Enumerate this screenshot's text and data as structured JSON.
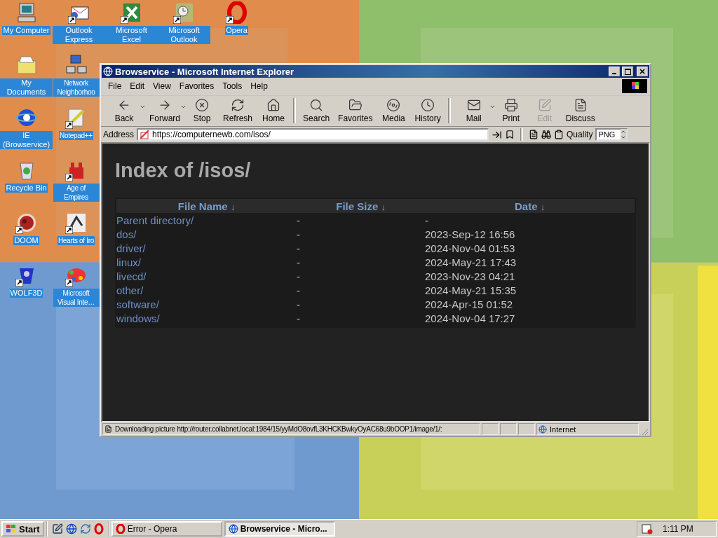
{
  "desktop_icons": [
    {
      "label": "My Computer",
      "shortcut": false
    },
    {
      "label": "Outlook Express",
      "shortcut": true
    },
    {
      "label": "Microsoft Excel",
      "shortcut": true
    },
    {
      "label": "Microsoft Outlook",
      "shortcut": true
    },
    {
      "label": "Opera",
      "shortcut": true
    },
    {
      "label": "My Documents",
      "shortcut": false
    },
    {
      "label": "Network Neighborhoo",
      "shortcut": false
    },
    {
      "label": "IE (Browservice)",
      "shortcut": false
    },
    {
      "label": "Notepad++",
      "shortcut": true
    },
    {
      "label": "Recycle Bin",
      "shortcut": false
    },
    {
      "label": "Age of Empires",
      "shortcut": true
    },
    {
      "label": "DOOM",
      "shortcut": true
    },
    {
      "label": "Hearts of Iro",
      "shortcut": true
    },
    {
      "label": "WOLF3D",
      "shortcut": true
    },
    {
      "label": "Microsoft Visual Inte…",
      "shortcut": true
    }
  ],
  "window": {
    "title": "Browservice - Microsoft Internet Explorer",
    "menu": [
      "File",
      "Edit",
      "View",
      "Favorites",
      "Tools",
      "Help"
    ],
    "toolbar": [
      [
        {
          "label": "Back",
          "dropdown": true,
          "disabled": false
        },
        {
          "label": "Forward",
          "dropdown": true,
          "disabled": false
        },
        {
          "label": "Stop",
          "dropdown": false,
          "disabled": false
        },
        {
          "label": "Refresh",
          "dropdown": false,
          "disabled": false
        },
        {
          "label": "Home",
          "dropdown": false,
          "disabled": false
        }
      ],
      [
        {
          "label": "Search",
          "dropdown": false,
          "disabled": false
        },
        {
          "label": "Favorites",
          "dropdown": false,
          "disabled": false
        },
        {
          "label": "Media",
          "dropdown": false,
          "disabled": false
        },
        {
          "label": "History",
          "dropdown": false,
          "disabled": false
        }
      ],
      [
        {
          "label": "Mail",
          "dropdown": true,
          "disabled": false
        },
        {
          "label": "Print",
          "dropdown": false,
          "disabled": false
        },
        {
          "label": "Edit",
          "dropdown": false,
          "disabled": true
        },
        {
          "label": "Discuss",
          "dropdown": false,
          "disabled": false
        }
      ]
    ],
    "address": {
      "label": "Address",
      "value": "https://computernewb.com/isos/"
    },
    "quality": {
      "label": "Quality",
      "value": "PNG"
    },
    "page": {
      "heading": "Index of /isos/",
      "columns": [
        {
          "label": "File Name",
          "sort_mark": "↓"
        },
        {
          "label": "File Size",
          "sort_mark": "↓"
        },
        {
          "label": "Date",
          "sort_mark": "↓"
        }
      ],
      "rows": [
        {
          "name": "Parent directory/",
          "size": "-",
          "date": "-"
        },
        {
          "name": "dos/",
          "size": "-",
          "date": "2023-Sep-12 16:56"
        },
        {
          "name": "driver/",
          "size": "-",
          "date": "2024-Nov-04 01:53"
        },
        {
          "name": "linux/",
          "size": "-",
          "date": "2024-May-21 17:43"
        },
        {
          "name": "livecd/",
          "size": "-",
          "date": "2023-Nov-23 04:21"
        },
        {
          "name": "other/",
          "size": "-",
          "date": "2024-May-21 15:35"
        },
        {
          "name": "software/",
          "size": "-",
          "date": "2024-Apr-15 01:52"
        },
        {
          "name": "windows/",
          "size": "-",
          "date": "2024-Nov-04 17:27"
        }
      ]
    },
    "status_bar": {
      "text": "Downloading picture http://router.collabnet.local:1984/15/yyMdO8ovfL3KHCKBwkyOyAC68u9bOOP1/image/1/:",
      "zone": "Internet"
    }
  },
  "taskbar": {
    "start": "Start",
    "tasks": [
      {
        "label": "Error - Opera",
        "selected": false
      },
      {
        "label": "Browservice - Micro...",
        "selected": true
      }
    ],
    "clock": "1:11 PM"
  }
}
